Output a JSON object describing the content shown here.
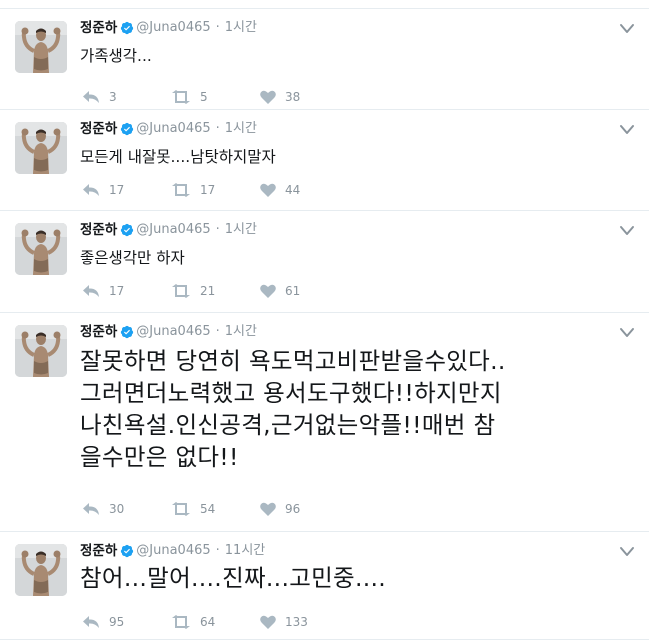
{
  "tweets": [
    {
      "name": "정준하",
      "handle": "@Juna0465",
      "time": "1시간",
      "text": "가족생각...",
      "replies": "3",
      "retweets": "5",
      "likes": "38"
    },
    {
      "name": "정준하",
      "handle": "@Juna0465",
      "time": "1시간",
      "text": "모든게 내잘못....남탓하지말자",
      "replies": "17",
      "retweets": "17",
      "likes": "44"
    },
    {
      "name": "정준하",
      "handle": "@Juna0465",
      "time": "1시간",
      "text": "좋은생각만 하자",
      "replies": "17",
      "retweets": "21",
      "likes": "61"
    },
    {
      "name": "정준하",
      "handle": "@Juna0465",
      "time": "1시간",
      "text": "잘못하면 당연히 욕도먹고비판받을수있다..\n그러면더노력했고 용서도구했다!!하지만지\n나친욕설.인신공격,근거없는악플!!매번 참\n을수만은 없다!!",
      "replies": "30",
      "retweets": "54",
      "likes": "96"
    },
    {
      "name": "정준하",
      "handle": "@Juna0465",
      "time": "11시간",
      "text": "참어...말어....진짜...고민중....",
      "replies": "95",
      "retweets": "64",
      "likes": "133"
    }
  ],
  "colors": {
    "verified": "#1da1f2",
    "muted": "#8a949c",
    "divider": "#e6ecf0"
  },
  "icons": {
    "reply": "reply-icon",
    "retweet": "retweet-icon",
    "like": "heart-icon",
    "menu": "chevron-down-icon",
    "verified": "verified-badge-icon"
  }
}
